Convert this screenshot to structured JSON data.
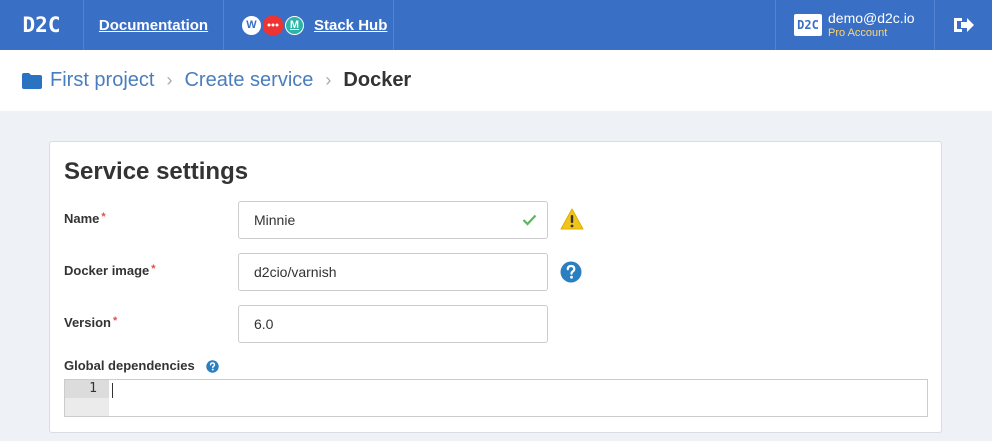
{
  "navbar": {
    "logo": "D2C",
    "docs_label": "Documentation",
    "stack_hub_label": "Stack Hub",
    "stack_icons": [
      "wordpress-icon",
      "chat-icon",
      "m-icon"
    ],
    "account": {
      "avatar_text": "D2C",
      "email": "demo@d2c.io",
      "role": "Pro Account"
    },
    "logout_icon": "logout-icon"
  },
  "breadcrumb": {
    "items": [
      "First project",
      "Create service"
    ],
    "current": "Docker",
    "separator": "›"
  },
  "panel": {
    "title": "Service settings",
    "fields": {
      "name": {
        "label": "Name",
        "required_mark": "*",
        "value": "Minnie"
      },
      "image": {
        "label": "Docker image",
        "required_mark": "*",
        "value": "d2cio/varnish"
      },
      "version": {
        "label": "Version",
        "required_mark": "*",
        "value": "6.0"
      }
    },
    "global_deps": {
      "label": "Global dependencies",
      "line_number": "1"
    }
  },
  "colors": {
    "navbar": "#3a6fc6",
    "link": "#4a7dbd",
    "warning": "#f0c419",
    "help": "#2a7fc1",
    "check": "#5cb85c",
    "required": "#d9534f"
  }
}
